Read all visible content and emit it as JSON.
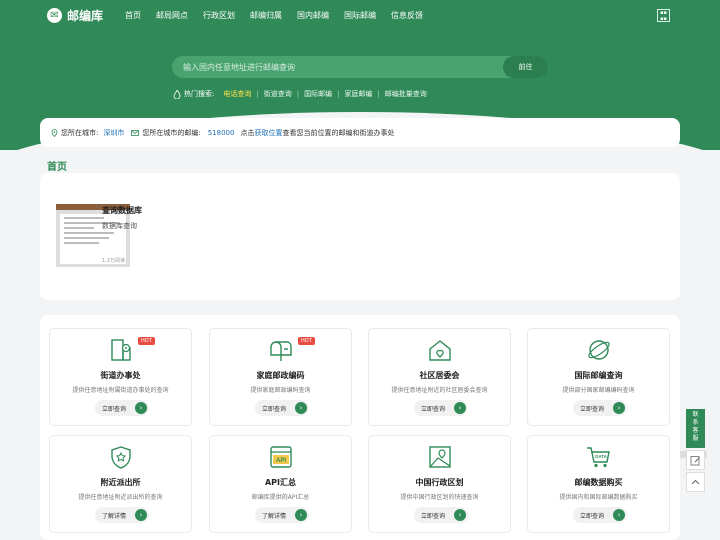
{
  "brand": {
    "name": "邮编库"
  },
  "nav": {
    "items": [
      "首页",
      "邮局网点",
      "行政区划",
      "邮编归属",
      "国内邮编",
      "国际邮编",
      "信息反馈"
    ]
  },
  "search": {
    "placeholder": "输入国内任意地址进行邮编查询",
    "button": "前往"
  },
  "hot": {
    "label": "热门搜索:",
    "items": [
      "电话查询",
      "街道查询",
      "国际邮编",
      "家庭邮编",
      "邮编批量查询"
    ]
  },
  "location": {
    "city_label": "您所在城市:",
    "city": "深圳市",
    "code_label": "您所在城市的邮编:",
    "code": "518000",
    "tip_prefix": "点击",
    "tip_link": "获取位置",
    "tip_suffix": "查看您当前位置的邮编和街道办事处"
  },
  "section": {
    "title": "首页"
  },
  "feature": {
    "title": "查询数据库",
    "subtitle": "数据库查询",
    "count": "1.2万阅读"
  },
  "services": [
    {
      "title": "街道办事处",
      "desc": "提供任意地址附属街道办事处的查询",
      "button": "立即查询",
      "hot": "HOT",
      "icon": "street-office-icon"
    },
    {
      "title": "家庭邮政编码",
      "desc": "提供家庭邮政编码查询",
      "button": "立即查询",
      "hot": "HOT",
      "icon": "mailbox-icon"
    },
    {
      "title": "社区居委会",
      "desc": "提供任意地址附近的社区居委会查询",
      "button": "立即查询",
      "hot": "",
      "icon": "house-icon"
    },
    {
      "title": "国际邮编查询",
      "desc": "提供部分国家邮编编码查询",
      "button": "立即查询",
      "hot": "",
      "icon": "globe-icon"
    },
    {
      "title": "附近派出所",
      "desc": "提供任意地址附近派出所的查询",
      "button": "了解详情",
      "hot": "",
      "icon": "police-shield-icon"
    },
    {
      "title": "API汇总",
      "desc": "邮编库提供的API汇总",
      "button": "了解详情",
      "hot": "",
      "icon": "api-icon"
    },
    {
      "title": "中国行政区划",
      "desc": "提供中国行政区划的快速查询",
      "button": "立即查询",
      "hot": "",
      "icon": "map-pin-icon"
    },
    {
      "title": "邮编数据购买",
      "desc": "提供国内和国际邮编数据购买",
      "button": "立即查询",
      "hot": "",
      "icon": "data-cart-icon"
    }
  ],
  "side": {
    "service": "联系客服"
  },
  "colors": {
    "brand_green": "#2f8a57",
    "link_blue": "#1d6db5",
    "hot_yellow": "#ffe34d",
    "hot_badge": "#e64d43"
  }
}
